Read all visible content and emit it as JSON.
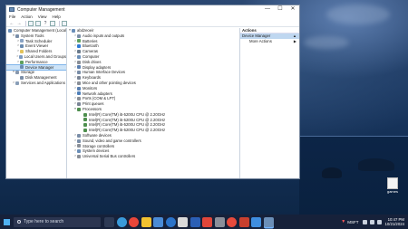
{
  "window": {
    "title": "Computer Management",
    "controls": {
      "minimize": "—",
      "maximize": "☐",
      "close": "✕"
    }
  },
  "menu": [
    "File",
    "Action",
    "View",
    "Help"
  ],
  "left_tree": [
    {
      "label": "Computer Management (Local",
      "indent": 0,
      "exp": "",
      "color": "#6b8fb8"
    },
    {
      "label": "System Tools",
      "indent": 1,
      "exp": "▾",
      "color": "#7a8ea8"
    },
    {
      "label": "Task Scheduler",
      "indent": 2,
      "exp": ">",
      "color": "#8aa4c4"
    },
    {
      "label": "Event Viewer",
      "indent": 2,
      "exp": ">",
      "color": "#6a8bb0"
    },
    {
      "label": "Shared Folders",
      "indent": 2,
      "exp": ">",
      "color": "#e3c35a"
    },
    {
      "label": "Local Users and Groups",
      "indent": 2,
      "exp": ">",
      "color": "#7b9ac0"
    },
    {
      "label": "Performance",
      "indent": 2,
      "exp": ">",
      "color": "#5ea05e"
    },
    {
      "label": "Device Manager",
      "indent": 2,
      "exp": "",
      "color": "#6a8bb0",
      "selected": true
    },
    {
      "label": "Storage",
      "indent": 1,
      "exp": "▾",
      "color": "#8898ad"
    },
    {
      "label": "Disk Management",
      "indent": 2,
      "exp": "",
      "color": "#7a8ea8"
    },
    {
      "label": "Services and Applications",
      "indent": 1,
      "exp": ">",
      "color": "#8a9fb8"
    }
  ],
  "device_tree": {
    "root": "abdzeoeir",
    "categories": [
      {
        "label": "Audio inputs and outputs",
        "exp": ">",
        "color": "#7a8ea8"
      },
      {
        "label": "Batteries",
        "exp": ">",
        "color": "#5ea05e"
      },
      {
        "label": "Bluetooth",
        "exp": ">",
        "color": "#2f7ad6"
      },
      {
        "label": "Cameras",
        "exp": ">",
        "color": "#6b7b8c"
      },
      {
        "label": "Computer",
        "exp": ">",
        "color": "#6b8fb8"
      },
      {
        "label": "Disk drives",
        "exp": ">",
        "color": "#8a8f97"
      },
      {
        "label": "Display adapters",
        "exp": ">",
        "color": "#5a7fb0"
      },
      {
        "label": "Human Interface Devices",
        "exp": ">",
        "color": "#7a8ea8"
      },
      {
        "label": "Keyboards",
        "exp": ">",
        "color": "#7a8596"
      },
      {
        "label": "Mice and other pointing devices",
        "exp": ">",
        "color": "#8a8f97"
      },
      {
        "label": "Monitors",
        "exp": ">",
        "color": "#5a7fb0"
      },
      {
        "label": "Network adapters",
        "exp": ">",
        "color": "#4f7fb8"
      },
      {
        "label": "Ports (COM & LPT)",
        "exp": ">",
        "color": "#8a8f97"
      },
      {
        "label": "Print queues",
        "exp": ">",
        "color": "#7a8596"
      },
      {
        "label": "Processors",
        "exp": "▾",
        "color": "#4e8f4e"
      }
    ],
    "processors": [
      "Intel(R) Core(TM) i5-5200U CPU @ 2.20GHz",
      "Intel(R) Core(TM) i5-5200U CPU @ 2.20GHz",
      "Intel(R) Core(TM) i5-5200U CPU @ 2.20GHz",
      "Intel(R) Core(TM) i5-5200U CPU @ 2.20GHz"
    ],
    "categories_after": [
      {
        "label": "Software devices",
        "exp": ">",
        "color": "#7a8ea8"
      },
      {
        "label": "Sound, video and game controllers",
        "exp": ">",
        "color": "#7a8ea8"
      },
      {
        "label": "Storage controllers",
        "exp": ">",
        "color": "#8a8f97"
      },
      {
        "label": "System devices",
        "exp": ">",
        "color": "#6b8fb8"
      },
      {
        "label": "Universal Serial Bus controllers",
        "exp": ">",
        "color": "#8a8f97"
      }
    ]
  },
  "actions": {
    "header": "Actions",
    "items": [
      {
        "label": "Device Manager",
        "arrow": "▲",
        "highlight": true
      },
      {
        "label": "More Actions",
        "arrow": "▶",
        "highlight": false
      }
    ]
  },
  "desktop_icon": {
    "label": "games"
  },
  "taskbar": {
    "search_placeholder": "Type here to search",
    "stock_ticker": "MSFT",
    "time": "10:47 PM",
    "date": "10/21/2024",
    "accent": "#6fb3ff"
  }
}
